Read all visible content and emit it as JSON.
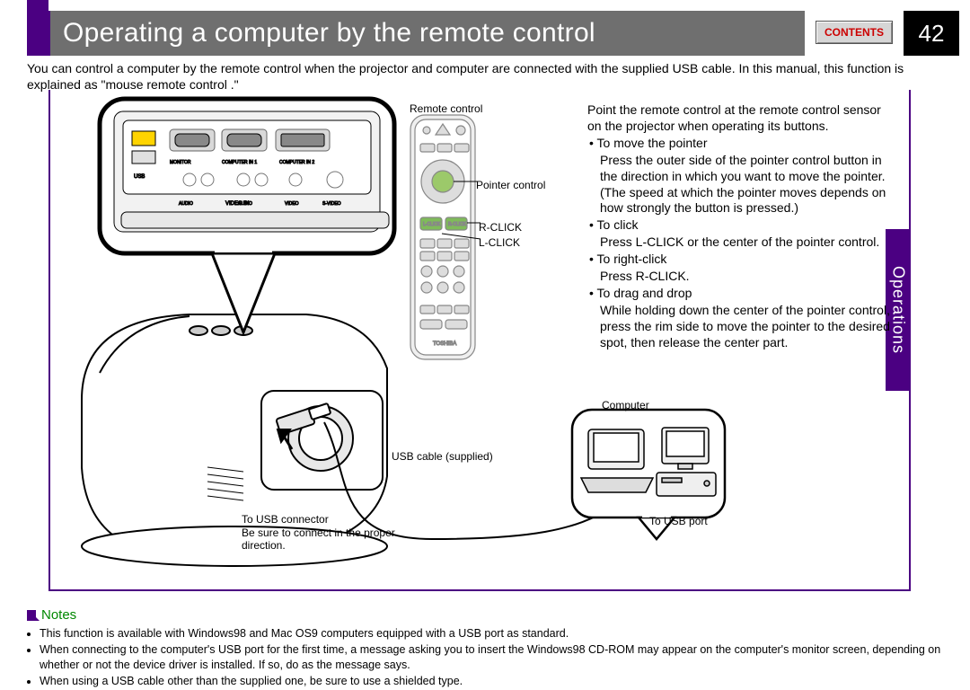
{
  "header": {
    "title": "Operating a computer by the remote control",
    "contents_btn": "CONTENTS",
    "page_number": "42"
  },
  "side_tab": "Operations",
  "intro": "You can control a computer by the remote control when the projector and computer are connected with the supplied USB cable. In this manual, this function is explained as \"mouse remote control .\"",
  "labels": {
    "remote_control": "Remote control",
    "pointer_control": "Pointer control",
    "r_click": "R-CLICK",
    "l_click": "L-CLICK",
    "computer": "Computer",
    "usb_cable": "USB cable (supplied)",
    "to_usb_connector": "To USB connector",
    "be_sure": "Be sure to connect in the proper direction.",
    "to_usb_port": "To USB port"
  },
  "instructions": {
    "intro": "Point the remote control at the remote control sensor on the projector when operating its buttons.",
    "items": [
      {
        "title": "To move the pointer",
        "body": "Press the outer side of the pointer control button in the direction in which you want to move the pointer. (The speed at which the pointer moves depends on how strongly the button is pressed.)"
      },
      {
        "title": "To click",
        "body": "Press L-CLICK or the center of the pointer control."
      },
      {
        "title": "To right-click",
        "body": "Press R-CLICK."
      },
      {
        "title": "To drag and drop",
        "body": "While holding down the center of the pointer control, press the rim side to move the pointer to the desired spot, then release the center part."
      }
    ]
  },
  "notes": {
    "heading": "Notes",
    "items": [
      "This function is available with Windows98 and Mac OS9 computers equipped with a USB port as standard.",
      "When connecting to the computer's USB port for the first time, a message asking you to insert the Windows98 CD-ROM may appear on the computer's monitor screen, depending on whether or not the device driver is installed. If so, do as the message says.",
      "When using a USB cable other than the supplied one, be sure to use a shielded type."
    ]
  }
}
